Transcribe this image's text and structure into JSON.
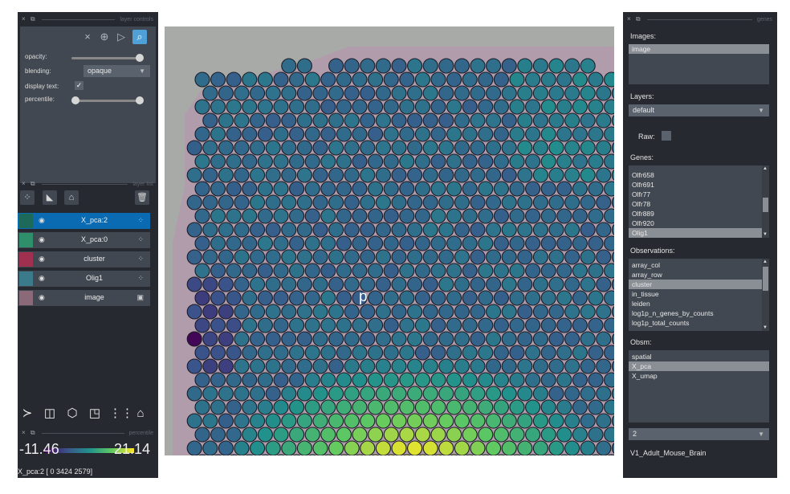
{
  "left_dock": {
    "controls_title": "layer controls",
    "mode_icons": [
      "close-icon",
      "add-points-icon",
      "select-icon",
      "pan-zoom-icon"
    ],
    "opacity_label": "opacity:",
    "opacity_value": 1.0,
    "blending_label": "blending:",
    "blending_value": "opaque",
    "display_text_label": "display text:",
    "display_text_checked": "✓",
    "percentile_label": "percentile:",
    "percentile_range": [
      0,
      1
    ],
    "list_title": "layer list",
    "layers": [
      {
        "name": "X_pca:2",
        "selected": true,
        "type_icon": "points-icon"
      },
      {
        "name": "X_pca:0",
        "selected": false,
        "type_icon": "points-icon"
      },
      {
        "name": "cluster",
        "selected": false,
        "type_icon": "points-icon"
      },
      {
        "name": "Olig1",
        "selected": false,
        "type_icon": "points-icon"
      },
      {
        "name": "image",
        "selected": false,
        "type_icon": "image-icon"
      }
    ],
    "percentile_title": "percentile",
    "colorbar_min": "-11.46",
    "colorbar_max": "21.14"
  },
  "canvas": {
    "overlay_text": "p",
    "colors": {
      "background": "#a7aaa6",
      "tissue": "#b98fb0",
      "spot_outline": "#1c1c26"
    }
  },
  "status": "X_pca:2 [   0 3424 2579]",
  "right_dock": {
    "title": "genes",
    "images_label": "Images:",
    "images": [
      {
        "name": "image",
        "selected": true
      }
    ],
    "layers_label": "Layers:",
    "layers_value": "default",
    "raw_label": "Raw:",
    "genes_label": "Genes:",
    "genes": [
      {
        "name": "Olfr658",
        "selected": false
      },
      {
        "name": "Olfr691",
        "selected": false
      },
      {
        "name": "Olfr77",
        "selected": false
      },
      {
        "name": "Olfr78",
        "selected": false
      },
      {
        "name": "Olfr889",
        "selected": false
      },
      {
        "name": "Olfr920",
        "selected": false
      },
      {
        "name": "Olig1",
        "selected": true
      }
    ],
    "obs_label": "Observations:",
    "observations": [
      {
        "name": "array_col",
        "selected": false
      },
      {
        "name": "array_row",
        "selected": false
      },
      {
        "name": "cluster",
        "selected": true
      },
      {
        "name": "in_tissue",
        "selected": false
      },
      {
        "name": "leiden",
        "selected": false
      },
      {
        "name": "log1p_n_genes_by_counts",
        "selected": false
      },
      {
        "name": "log1p_total_counts",
        "selected": false
      }
    ],
    "obsm_label": "Obsm:",
    "obsm": [
      {
        "name": "spatial",
        "selected": false
      },
      {
        "name": "X_pca",
        "selected": true
      },
      {
        "name": "X_umap",
        "selected": false
      }
    ],
    "dim_value": "2",
    "library_id": "V1_Adult_Mouse_Brain"
  }
}
